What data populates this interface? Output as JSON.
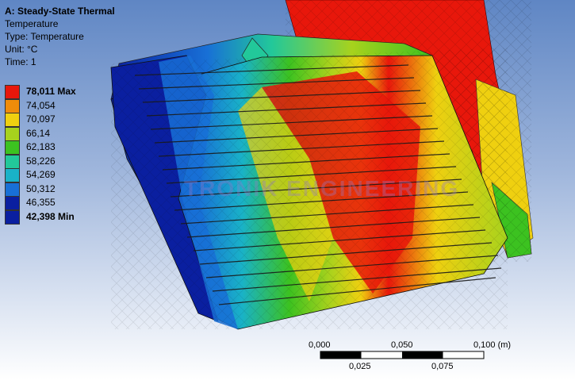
{
  "header": {
    "title": "A: Steady-State Thermal",
    "result": "Temperature",
    "type_line": "Type: Temperature",
    "unit_line": "Unit: °C",
    "time_line": "Time: 1"
  },
  "legend": {
    "entries": [
      {
        "label": "78,011 Max",
        "color": "#e8170b"
      },
      {
        "label": "74,054",
        "color": "#ef8c0a"
      },
      {
        "label": "70,097",
        "color": "#efd010"
      },
      {
        "label": "66,14",
        "color": "#a7d21d"
      },
      {
        "label": "62,183",
        "color": "#3cc220"
      },
      {
        "label": "58,226",
        "color": "#22c89a"
      },
      {
        "label": "54,269",
        "color": "#19b2c8"
      },
      {
        "label": "50,312",
        "color": "#1870d6"
      },
      {
        "label": "46,355",
        "color": "#0a1fa0"
      },
      {
        "label": "42,398 Min",
        "color": "#0a1fa0"
      }
    ]
  },
  "scale_bar": {
    "top_labels": [
      "0,000",
      "0,050",
      "0,100 (m)"
    ],
    "bottom_labels": [
      "0,025",
      "0,075"
    ]
  },
  "watermark": "TRONIK ENGINEERING",
  "colors": {
    "red": "#e8170b",
    "orange": "#ef8c0a",
    "yellow": "#efd010",
    "yellowgreen": "#a7d21d",
    "green": "#3cc220",
    "cyan": "#19b2c8",
    "blue": "#1870d6",
    "darkblue": "#0a1fa0"
  }
}
